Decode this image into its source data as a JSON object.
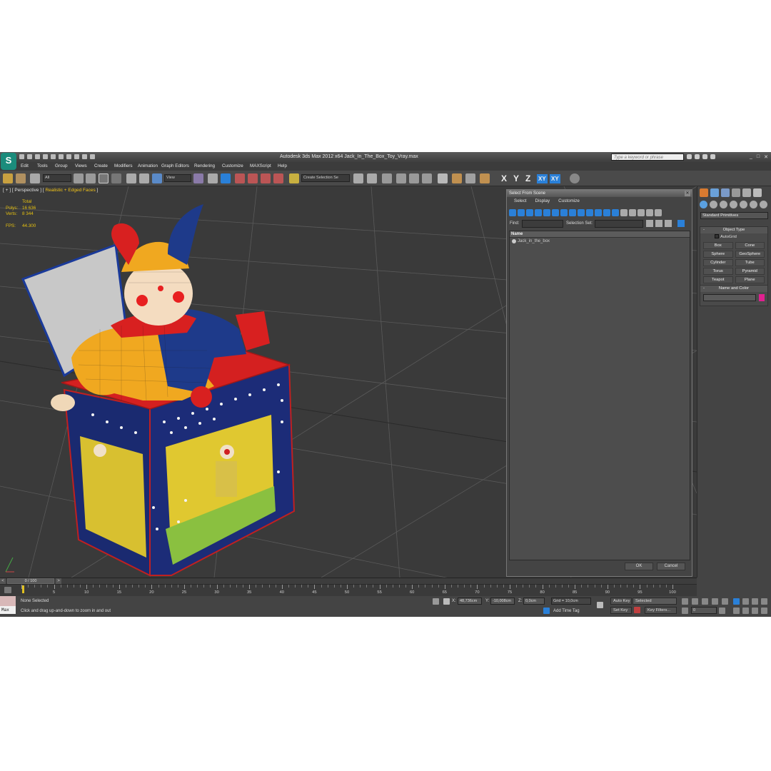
{
  "window": {
    "title": "Autodesk 3ds Max  2012 x64     Jack_In_The_Box_Toy_Vray.max",
    "search_placeholder": "Type a keyword or phrase",
    "logo_text": "S"
  },
  "menu": [
    "Edit",
    "Tools",
    "Group",
    "Views",
    "Create",
    "Modifiers",
    "Animation",
    "Graph Editors",
    "Rendering",
    "Customize",
    "MAXScript",
    "Help"
  ],
  "toolbar": {
    "filter_value": "All",
    "ref_coord_value": "View",
    "selection_set_placeholder": "Create Selection Se",
    "axis_x": "X",
    "axis_y": "Y",
    "axis_z": "Z",
    "axis_xy": "XY",
    "axis_xy2": "XY"
  },
  "viewport": {
    "label_prefix": "[ + ] [ Perspective ] [ ",
    "label_shading": "Realistic + Edged Faces",
    "label_suffix": " ]",
    "stats_header": "Total",
    "polys_label": "Polys:",
    "polys_value": "16 636",
    "verts_label": "Verts:",
    "verts_value": "8 344",
    "fps_label": "FPS:",
    "fps_value": "44.300"
  },
  "dialog": {
    "title": "Select From Scene",
    "menu": [
      "Select",
      "Display",
      "Customize"
    ],
    "find_label": "Find:",
    "selection_set_label": "Selection Set:",
    "column_name": "Name",
    "items": [
      "Jack_in_the_box"
    ],
    "ok_label": "OK",
    "cancel_label": "Cancel"
  },
  "command_panel": {
    "category": "Standard Primitives",
    "object_type_title": "Object Type",
    "autogrid_label": "AutoGrid",
    "primitives": [
      "Box",
      "Cone",
      "Sphere",
      "GeoSphere",
      "Cylinder",
      "Tube",
      "Torus",
      "Pyramid",
      "Teapot",
      "Plane"
    ],
    "name_color_title": "Name and Color",
    "color": "#e02090"
  },
  "timeline": {
    "slider_label": "0 / 100",
    "ticks": [
      "5",
      "10",
      "15",
      "20",
      "25",
      "30",
      "35",
      "40",
      "45",
      "50",
      "55",
      "60",
      "65",
      "70",
      "75",
      "80",
      "85",
      "90",
      "95",
      "100"
    ]
  },
  "status": {
    "listener_label": "Max",
    "selection_status": "None Selected",
    "prompt": "Click and drag up-and-down to zoom in and out",
    "x_label": "X:",
    "x_value": "48,736cm",
    "y_label": "Y:",
    "y_value": "-10,008cm",
    "z_label": "Z:",
    "z_value": "0,0cm",
    "grid": "Grid = 10,0cm",
    "add_time_tag": "Add Time Tag",
    "auto_key": "Auto Key",
    "set_key": "Set Key",
    "selected_value": "Selected",
    "key_filters": "Key Filters...",
    "frame_value": "0"
  }
}
